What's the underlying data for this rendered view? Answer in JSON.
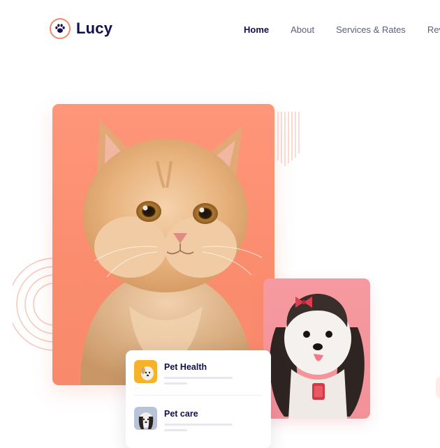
{
  "brand": {
    "name": "Lucy",
    "icon": "paw-icon",
    "accent": "#f08a6c"
  },
  "nav": {
    "items": [
      {
        "label": "Home",
        "active": true
      },
      {
        "label": "About",
        "active": false
      },
      {
        "label": "Services & Rates",
        "active": false
      },
      {
        "label": "Rev",
        "active": false
      }
    ]
  },
  "services": {
    "items": [
      {
        "title": "Pet Health",
        "thumb": "dog-thumbnail"
      },
      {
        "title": "Pet care",
        "thumb": "dog-thumbnail"
      }
    ]
  },
  "colors": {
    "navy": "#12104a",
    "cat_bg": "#fb8d6f",
    "dog_bg": "#f39198"
  }
}
